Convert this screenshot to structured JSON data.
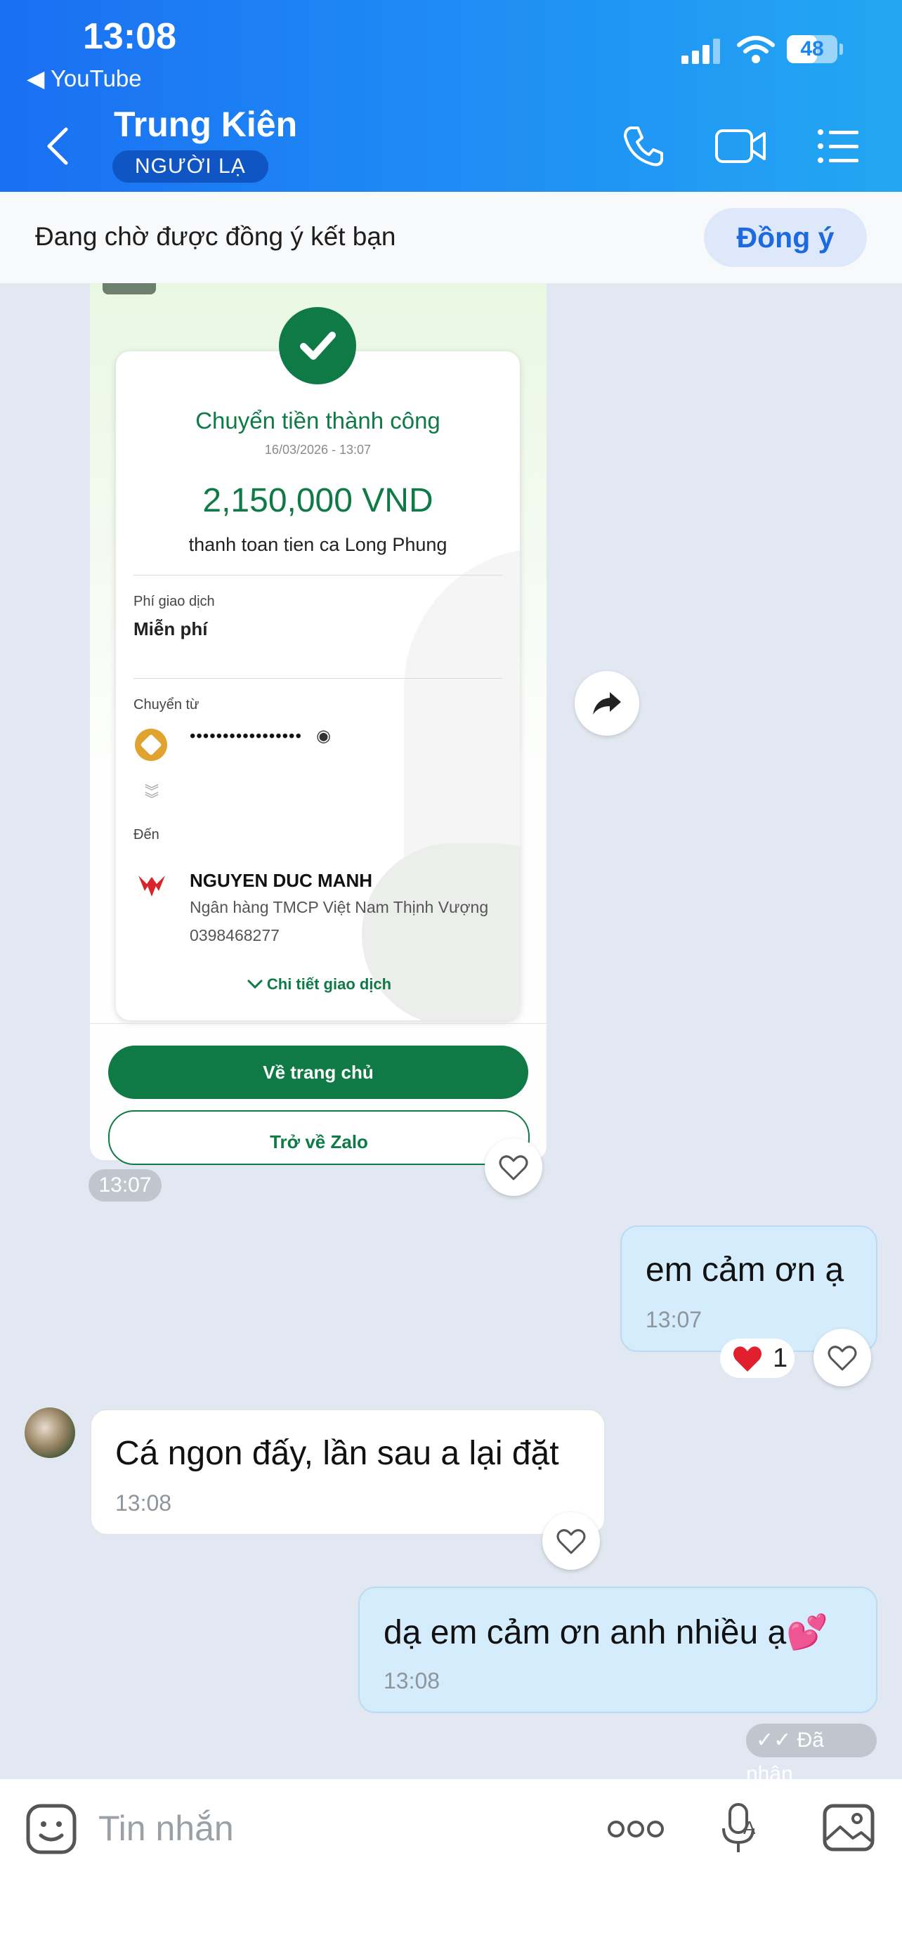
{
  "status_bar": {
    "time": "13:08",
    "back_app": "◀ YouTube",
    "battery": "48"
  },
  "header": {
    "name": "Trung Kiên",
    "badge": "NGƯỜI LẠ"
  },
  "friend_request": {
    "text": "Đang chờ được đồng ý kết bạn",
    "accept_label": "Đồng ý"
  },
  "receipt": {
    "title": "Chuyển tiền thành công",
    "datetime": "16/03/2026 - 13:07",
    "amount": "2,150,000 VND",
    "description": "thanh toan tien ca Long Phung",
    "fee_label": "Phí giao dịch",
    "fee_value": "Miễn phí",
    "from_label": "Chuyển từ",
    "from_account": "•••••••••••••••••",
    "to_label": "Đến",
    "to_name": "NGUYEN DUC MANH",
    "to_bank": "Ngân hàng TMCP Việt Nam Thịnh Vượng",
    "to_phone": "0398468277",
    "details_link": "Chi tiết giao dịch",
    "home_button": "Về trang chủ",
    "zalo_button": "Trở về Zalo"
  },
  "image_time": "13:07",
  "messages": [
    {
      "direction": "out",
      "text": "em cảm ơn ạ",
      "time": "13:07",
      "reaction": {
        "emoji": "heart",
        "count": "1"
      }
    },
    {
      "direction": "in",
      "text": "Cá ngon đấy, lần sau a lại đặt",
      "time": "13:08"
    },
    {
      "direction": "out",
      "text": "dạ em cảm ơn anh nhiều ạ💕",
      "time": "13:08"
    }
  ],
  "delivery_status": "✓✓ Đã nhận",
  "input": {
    "placeholder": "Tin nhắn"
  },
  "colors": {
    "header_start": "#1a6ff2",
    "header_end": "#23a7f2",
    "bank_green": "#0f7a45",
    "outgoing_bubble": "#d4ecfb"
  }
}
